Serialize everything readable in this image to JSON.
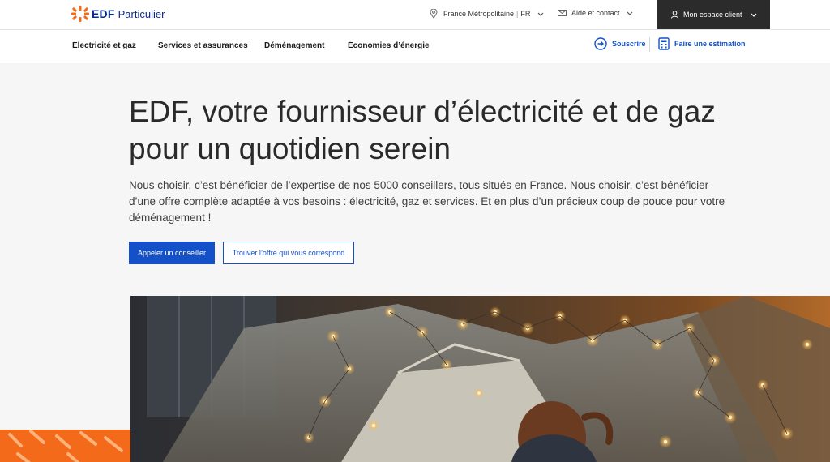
{
  "header": {
    "brand_edf": "EDF",
    "brand_sub": "Particulier",
    "region_label": "France Métropolitaine",
    "language": "FR",
    "help_label": "Aide et contact",
    "account_label": "Mon espace client",
    "brand_colors": {
      "orange": "#f36a1a",
      "blue": "#0a2a8c",
      "accent": "#1450c8"
    }
  },
  "nav": {
    "items": [
      {
        "label": "Électricité et gaz"
      },
      {
        "label": "Services et assurances"
      },
      {
        "label": "Déménagement"
      },
      {
        "label": "Économies d’énergie"
      }
    ],
    "subscribe_label": "Souscrire",
    "estimate_label": "Faire une estimation",
    "icons": {
      "subscribe": "arrow-circle-icon",
      "estimate": "calculator-icon"
    }
  },
  "hero": {
    "title": "EDF, votre fournisseur d’électricité et de gaz pour un quotidien serein",
    "lead": "Nous choisir, c’est bénéficier de l’expertise de nos 5000 conseillers, tous situés en France. Nous choisir, c’est bénéficier d’une offre complète adaptée à vos besoins : électricité, gaz et services. Et en plus d’un précieux coup de pouce pour votre déménagement !",
    "primary_button": "Appeler un conseiller",
    "secondary_button": "Trouver l’offre qui vous correspond"
  }
}
